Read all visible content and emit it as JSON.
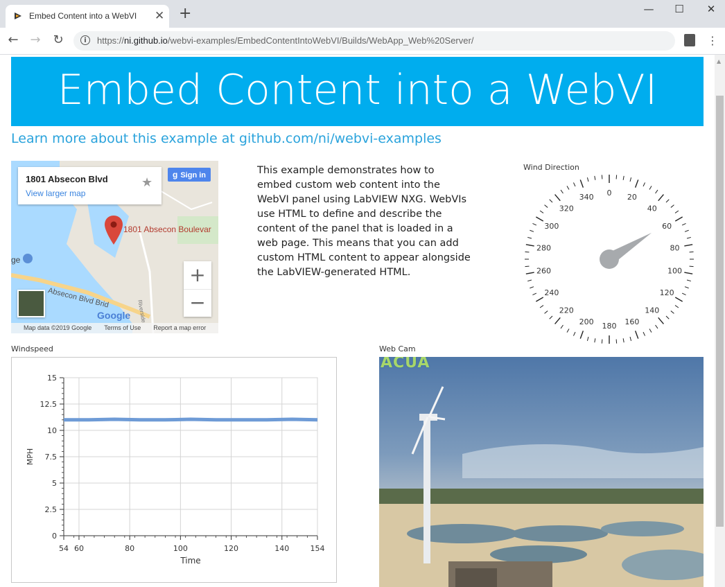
{
  "browser": {
    "tab_title": "Embed Content into a WebVI",
    "tab_close": "✕",
    "new_tab": "+",
    "url_prefix": "https://",
    "url_host": "ni.github.io",
    "url_path": "/webvi-examples/EmbedContentIntoWebVI/Builds/WebApp_Web%20Server/",
    "window_controls": {
      "minimize": "—",
      "maximize": "☐",
      "close": "✕"
    },
    "nav": {
      "back": "←",
      "forward": "→",
      "reload": "↻"
    }
  },
  "page": {
    "title": "Embed Content into a WebVI",
    "learn_link": "Learn more about this example at github.com/ni/webvi-examples",
    "description": "This example demonstrates how to embed custom web content into the WebVI panel using LabVIEW NXG. WebVIs use HTML to define and describe the content of the panel that is loaded in a web page. This means that you can add custom HTML content to appear alongside the LabVIEW-generated HTML."
  },
  "map": {
    "place_title": "1801 Absecon Blvd",
    "view_larger": "View larger map",
    "sign_in": "Sign in",
    "pin_label": "1801 Absecon Boulevar",
    "road_label": "Absecon Blvd Brid",
    "side_label": "ge",
    "road_vertical": "Riverside",
    "google": "Google",
    "zoom_in": "+",
    "zoom_out": "−",
    "footer": {
      "data": "Map data ©2019 Google",
      "terms": "Terms of Use",
      "report": "Report a map error"
    }
  },
  "gauge": {
    "label": "Wind Direction",
    "value_degrees": 58,
    "ticks": [
      "0",
      "20",
      "40",
      "60",
      "80",
      "100",
      "120",
      "140",
      "160",
      "180",
      "200",
      "220",
      "240",
      "260",
      "280",
      "300",
      "320",
      "340"
    ],
    "colors": {
      "needle": "#a7aaad",
      "ticks": "#222222"
    }
  },
  "windspeed": {
    "label": "Windspeed",
    "chart_data": {
      "type": "line",
      "xlabel": "Time",
      "ylabel": "MPH",
      "xlim": [
        54,
        154
      ],
      "ylim": [
        0,
        15
      ],
      "x_ticks": [
        "54",
        "60",
        "80",
        "100",
        "120",
        "140",
        "154"
      ],
      "y_ticks": [
        "0",
        "2.5",
        "5",
        "7.5",
        "10",
        "12.5",
        "15"
      ],
      "grid": true,
      "series": [
        {
          "color": "#6e9bd6",
          "x": [
            54,
            64,
            74,
            84,
            94,
            104,
            114,
            124,
            134,
            144,
            154
          ],
          "values": [
            11.0,
            11.0,
            11.05,
            11.0,
            11.0,
            11.05,
            11.0,
            11.0,
            11.0,
            11.05,
            11.0
          ]
        }
      ]
    }
  },
  "webcam": {
    "label": "Web Cam",
    "overlay_text": "ACUA"
  }
}
